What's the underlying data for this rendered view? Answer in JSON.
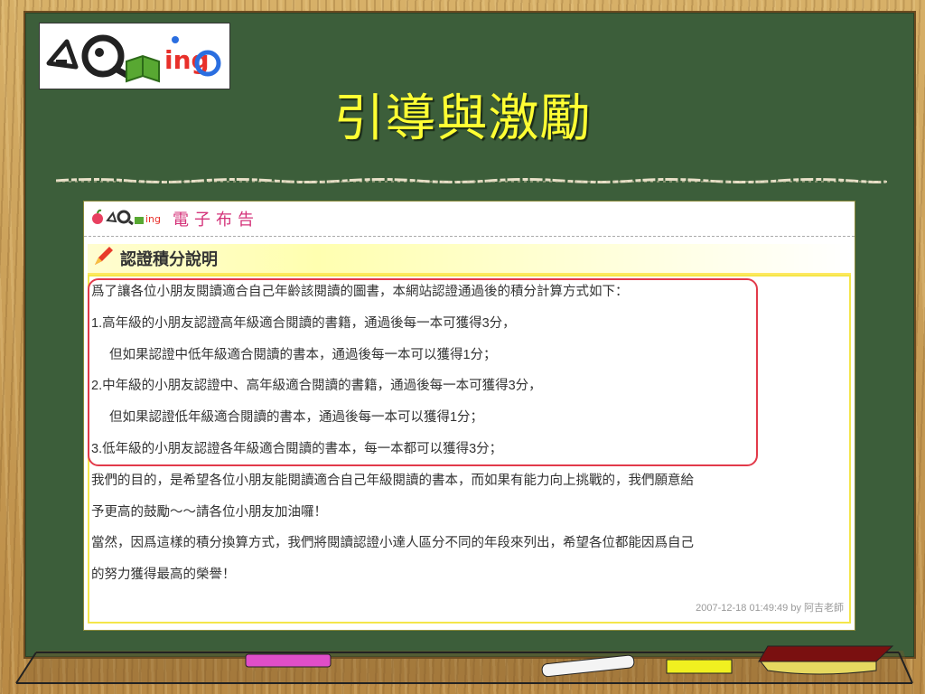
{
  "slide": {
    "title": "引導與激勵",
    "colors": {
      "board": "#3c5e3a",
      "title": "#ffff33",
      "frame": "#c9a25a"
    }
  },
  "logo": {
    "name": "Go reading logo",
    "icon": "book-magnifier-icon",
    "text": "ing"
  },
  "screenshot": {
    "header": {
      "brand": "電子布告",
      "logo_text": "ing",
      "icon": "apple-icon"
    },
    "section": {
      "icon": "pencil-icon",
      "title": "認證積分說明"
    },
    "lines": [
      "爲了讓各位小朋友閱讀適合自己年齡該閱讀的圖書，本網站認證通過後的積分計算方式如下：",
      "1.高年級的小朋友認證高年級適合閱讀的書籍，通過後每一本可獲得3分，",
      "但如果認證中低年級適合閱讀的書本，通過後每一本可以獲得1分；",
      "2.中年級的小朋友認證中、高年級適合閱讀的書籍，通過後每一本可獲得3分，",
      "但如果認證低年級適合閱讀的書本，通過後每一本可以獲得1分；",
      "3.低年級的小朋友認證各年級適合閱讀的書本，每一本都可以獲得3分；",
      "我們的目的，是希望各位小朋友能閱讀適合自己年級閱讀的書本，而如果有能力向上挑戰的，我們願意給",
      "予更高的鼓勵～～請各位小朋友加油囉！",
      "當然，因爲這樣的積分換算方式，我們將閱讀認證小達人區分不同的年段來列出，希望各位都能因爲自己",
      "的努力獲得最高的榮譽！"
    ],
    "footer": "2007-12-18 01:49:49 by 阿吉老師",
    "highlight_color": "#e23a4a"
  },
  "chalk_ledge": {
    "items": [
      "pink-chalk",
      "white-chalk",
      "yellow-chalk",
      "eraser"
    ]
  }
}
